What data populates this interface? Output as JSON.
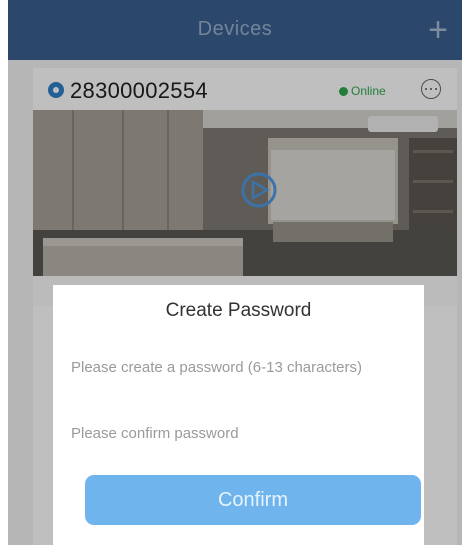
{
  "header": {
    "title": "Devices",
    "add_label": "+"
  },
  "device": {
    "id": "28300002554",
    "status": "Online"
  },
  "dialog": {
    "title": "Create Password",
    "password_placeholder": "Please create a password (6-13 characters)",
    "confirm_placeholder": "Please confirm password",
    "confirm_label": "Confirm"
  },
  "colors": {
    "nav_background": "#3a5f91",
    "accent": "#6fb4ec",
    "online": "#2ea94a",
    "device_icon": "#2f80c8"
  },
  "icons": [
    "add-icon",
    "device-icon",
    "status-dot-icon",
    "more-options-icon",
    "play-icon"
  ]
}
